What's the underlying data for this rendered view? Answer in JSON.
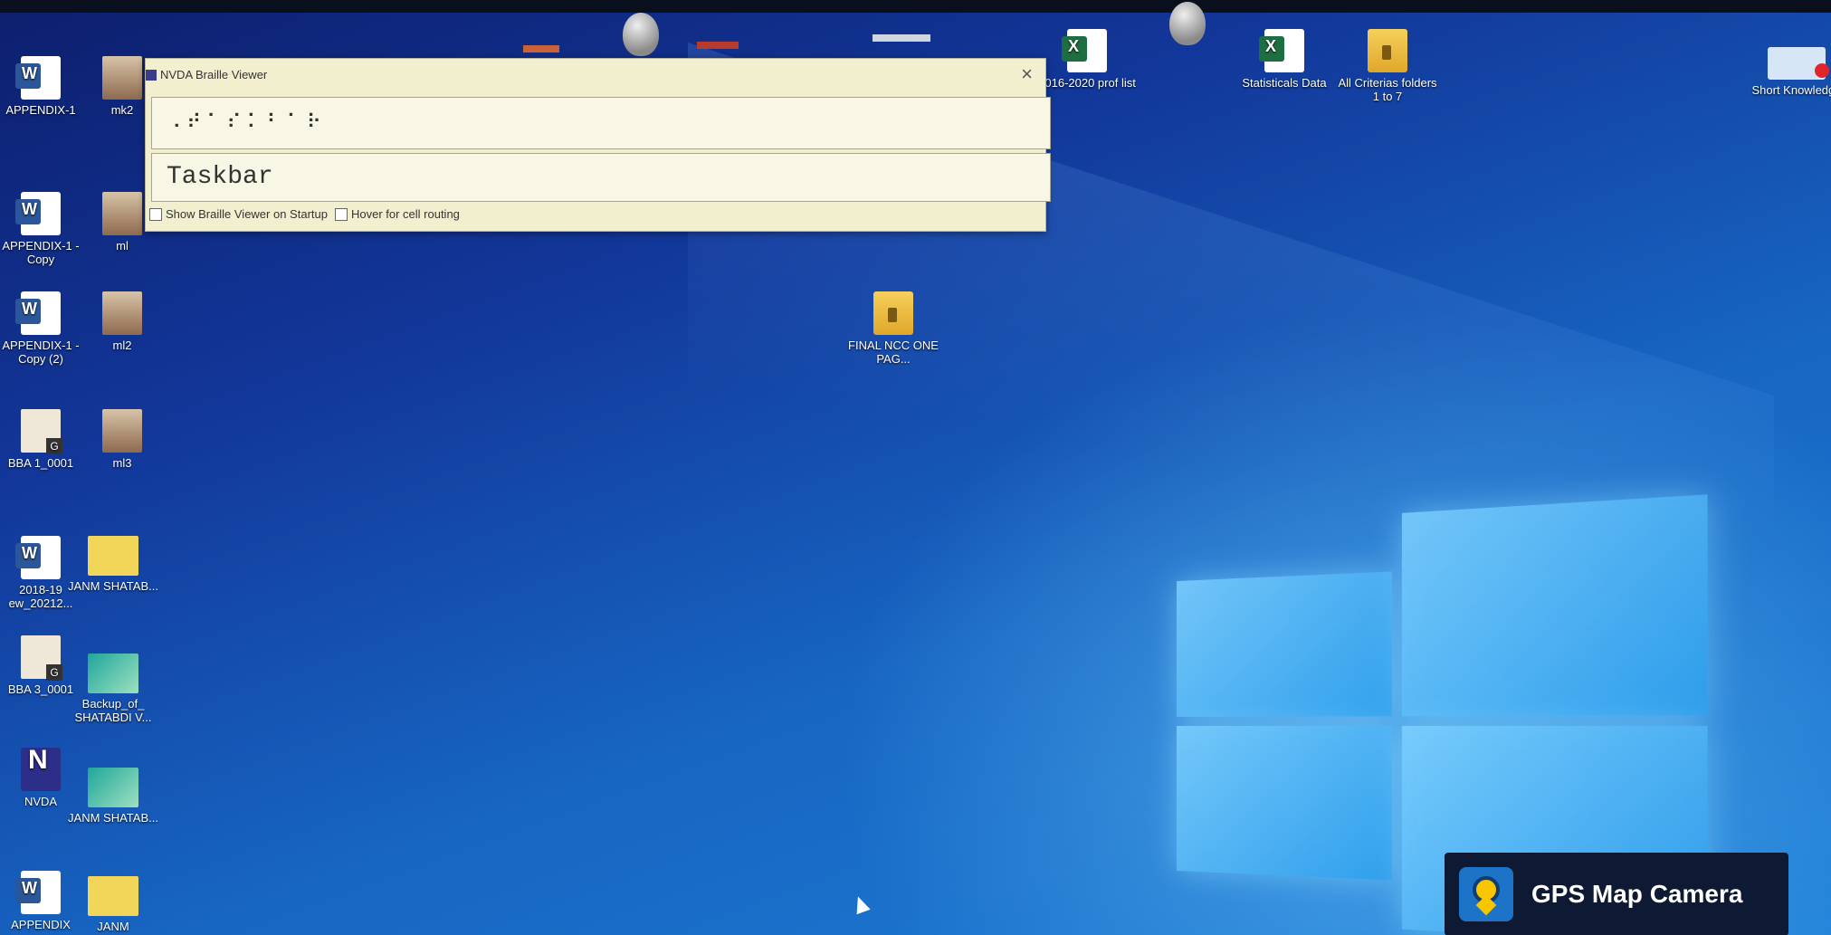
{
  "braille_viewer": {
    "title": "NVDA Braille Viewer",
    "cells": "⠠⠞⠁⠎⠅⠃⠁⠗",
    "text": "Taskbar",
    "opt1": "Show Braille Viewer on Startup",
    "opt2": "Hover for cell routing",
    "close": "×"
  },
  "desktop_icons": [
    {
      "label": "APPENDIX-1",
      "type": "word-icon"
    },
    {
      "label": "mk2",
      "type": "photo-icon"
    },
    {
      "label": "APPENDIX-1 - Copy",
      "type": "word-icon"
    },
    {
      "label": "ml",
      "type": "photo-icon"
    },
    {
      "label": "APPENDIX-1 - Copy (2)",
      "type": "word-icon"
    },
    {
      "label": "ml2",
      "type": "photo-icon"
    },
    {
      "label": "BBA 1_0001",
      "type": "document-icon"
    },
    {
      "label": "ml3",
      "type": "photo-icon"
    },
    {
      "label": "2018-19 ew_20212...",
      "type": "word-icon"
    },
    {
      "label": "JANM SHATAB...",
      "type": "card-icon"
    },
    {
      "label": "BBA 3_0001",
      "type": "document-icon"
    },
    {
      "label": "Backup_of_ SHATABDI V...",
      "type": "card-icon"
    },
    {
      "label": "NVDA",
      "type": "nvda-icon"
    },
    {
      "label": "JANM SHATAB...",
      "type": "card-icon"
    },
    {
      "label": "APPENDIX",
      "type": "word-icon"
    },
    {
      "label": "JANM",
      "type": "card-icon"
    },
    {
      "label": "2016-2020 prof list",
      "type": "excel-icon"
    },
    {
      "label": "Statisticals Data",
      "type": "excel-icon"
    },
    {
      "label": "All Criterias folders 1 to 7",
      "type": "folder-icon"
    },
    {
      "label": "Short Knowledge",
      "type": "pdf-shortcut-icon"
    },
    {
      "label": "FINAL NCC ONE PAG...",
      "type": "folder-icon"
    }
  ],
  "watermark": {
    "app_name": "GPS Map Camera"
  },
  "colors": {
    "desktop_top": "#0d1f6e",
    "desktop_bottom": "#1e7fd6",
    "window_bg": "#f2efcf",
    "gps_bg": "#0e1a33"
  }
}
